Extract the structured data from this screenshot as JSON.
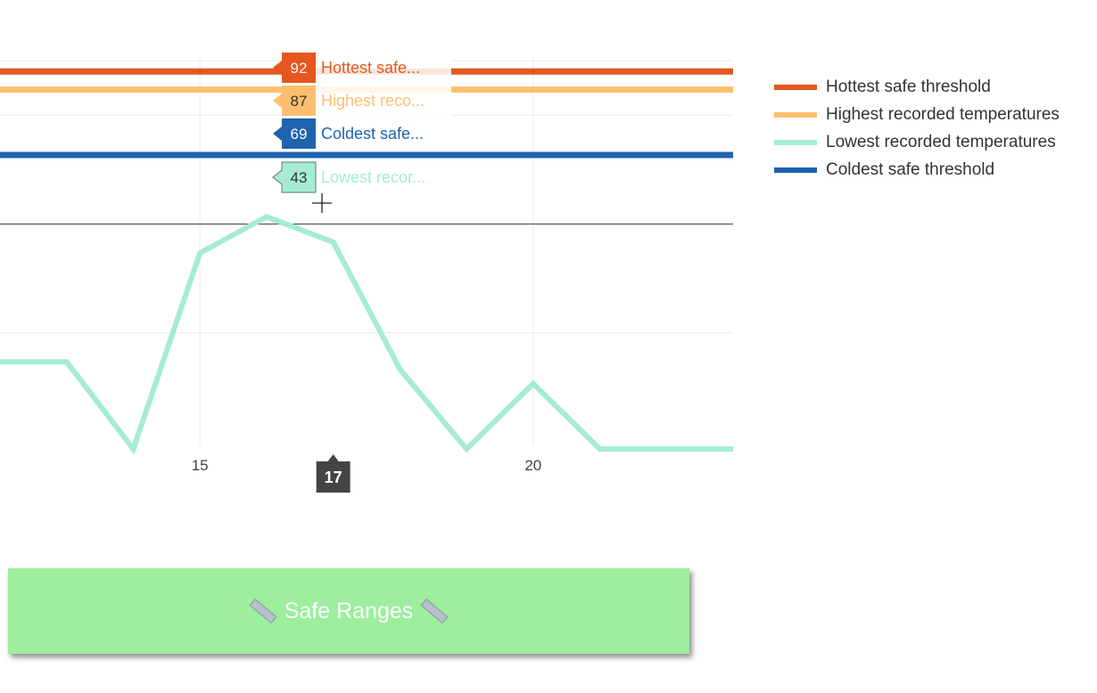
{
  "chart_data": {
    "type": "line",
    "xlim": [
      12,
      23
    ],
    "ylim": [
      -11,
      96
    ],
    "x_ticks": [
      15,
      20
    ],
    "grid": true,
    "zero_line": 50,
    "legend_position": "right",
    "series": [
      {
        "name": "Hottest safe threshold",
        "short": "Hottest safe...",
        "color": "#e4571e",
        "x": [
          12,
          23
        ],
        "y": [
          92,
          92
        ]
      },
      {
        "name": "Highest recorded temperatures",
        "short": "Highest reco...",
        "color": "#fdbf6f",
        "x": [
          12,
          23
        ],
        "y": [
          87,
          87
        ]
      },
      {
        "name": "Lowest recorded temperatures",
        "short": "Lowest recor...",
        "color": "#a6ecd3",
        "x": [
          12,
          13,
          14,
          15,
          16,
          17,
          18,
          19,
          20,
          21,
          22,
          23
        ],
        "y": [
          12,
          12,
          -12,
          42,
          52,
          45,
          10,
          -12,
          6,
          -12,
          -12,
          -12
        ]
      },
      {
        "name": "Coldest safe threshold",
        "short": "Coldest safe...",
        "color": "#1f63ae",
        "x": [
          12,
          23
        ],
        "y": [
          69,
          69
        ]
      }
    ],
    "hover": {
      "x": 17,
      "x_label": "17",
      "labels": [
        {
          "series": 0,
          "value": "92"
        },
        {
          "series": 1,
          "value": "87"
        },
        {
          "series": 3,
          "value": "69"
        },
        {
          "series": 2,
          "value": "43"
        }
      ]
    }
  },
  "button": {
    "label": "Safe Ranges",
    "color": "#9dee9d"
  }
}
